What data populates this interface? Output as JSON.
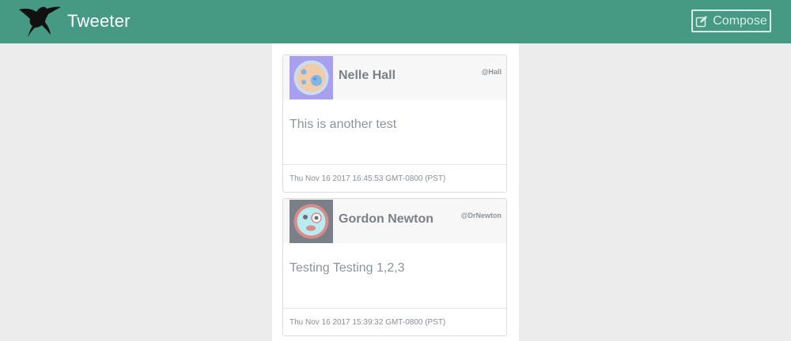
{
  "header": {
    "brand": "Tweeter",
    "logo_icon": "hummingbird-icon",
    "compose_label": "Compose",
    "compose_icon": "edit-icon"
  },
  "tweets": [
    {
      "author": "Nelle Hall",
      "handle": "@Hall",
      "content": "This is another test",
      "timestamp": "Thu Nov 16 2017 16:45:53 GMT-0800 (PST)"
    },
    {
      "author": "Gordon Newton",
      "handle": "@DrNewton",
      "content": "Testing Testing 1,2,3",
      "timestamp": "Thu Nov 16 2017 15:39:32 GMT-0800 (PST)"
    }
  ],
  "colors": {
    "navbar": "#469a84",
    "page_background": "#ececec"
  }
}
